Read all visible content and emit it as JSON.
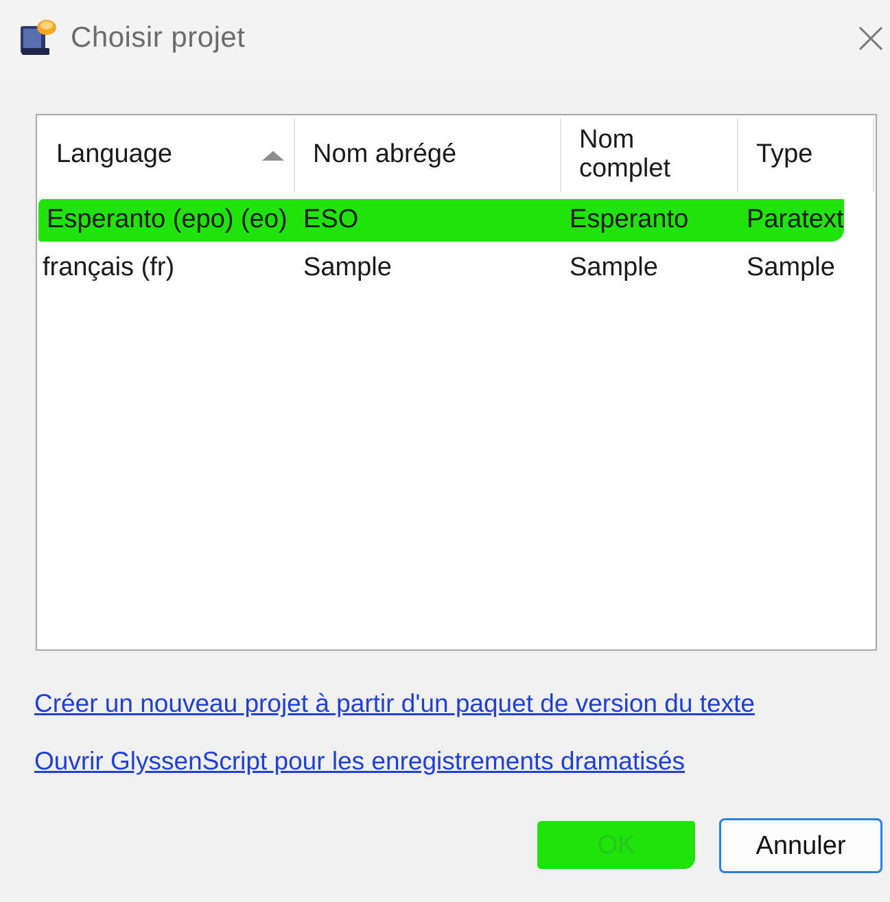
{
  "window": {
    "title": "Choisir projet",
    "app_icon": "glyssen-app-icon",
    "close_icon": "close-icon"
  },
  "table": {
    "columns": [
      {
        "label": "Language",
        "sorted": "ascending"
      },
      {
        "label": "Nom abrégé"
      },
      {
        "label_line1": "Nom",
        "label_line2": "complet"
      },
      {
        "label": "Type"
      }
    ],
    "rows": [
      {
        "language": "Esperanto (epo) (eo)",
        "short_name": "ESO",
        "full_name": "Esperanto",
        "type": "Paratext",
        "selected": true
      },
      {
        "language": "français (fr)",
        "short_name": "Sample",
        "full_name": "Sample",
        "type": "Sample",
        "selected": false
      }
    ],
    "highlight_color": "#1fe30a"
  },
  "links": {
    "create_project": "Créer un nouveau projet à partir d'un paquet de version du texte",
    "open_glyssenscript": "Ouvrir GlyssenScript pour les enregistrements dramatisés"
  },
  "buttons": {
    "ok_label": "OK",
    "cancel_label": "Annuler"
  }
}
